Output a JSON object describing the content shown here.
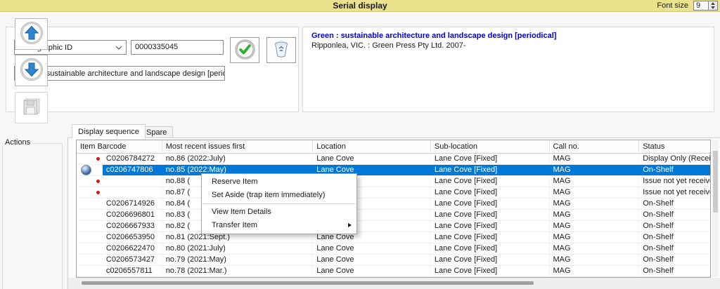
{
  "colors": {
    "titlebar_bg": "#eae28d",
    "selection": "#0078d7",
    "record_title": "#0000e6",
    "red_dot": "#dd1111"
  },
  "window": {
    "title": "Serial display",
    "font_size_label": "Font size",
    "font_size_value": "9"
  },
  "lookup": {
    "field_selector_value": "Bibliographic ID",
    "id_value": "0000335045",
    "title_selector_value": "Green : sustainable architecture and landscape design [perio"
  },
  "record": {
    "title": "Green : sustainable architecture and landscape design [periodical]",
    "imprint": "Ripponlea, VIC. : Green Press Pty Ltd. 2007-"
  },
  "actions": {
    "label": "Actions"
  },
  "tabs": [
    {
      "label": "Display sequence",
      "active": true
    },
    {
      "label": "Spare",
      "active": false
    }
  ],
  "table": {
    "columns": [
      "Item Barcode",
      "Most recent issues first",
      "Location",
      "Sub-location",
      "Call no.",
      "Status"
    ],
    "rows": [
      {
        "marker": "red-dot",
        "barcode": "C0206784272",
        "issue": "no.86 (2022:July)",
        "location": "Lane Cove",
        "sublocation": "Lane Cove [Fixed]",
        "call_no": "MAG",
        "status": "Display Only (Receive",
        "selected": false
      },
      {
        "marker": "sphere",
        "barcode": "c0206747806",
        "issue": "no.85 (2022:May)",
        "location": "Lane Cove",
        "sublocation": "Lane Cove [Fixed]",
        "call_no": "MAG",
        "status": "On-Shelf",
        "selected": true
      },
      {
        "marker": "red-dot",
        "barcode": "",
        "issue": "no.88 (",
        "location": "",
        "sublocation": "Lane Cove [Fixed]",
        "call_no": "MAG",
        "status": "Issue not yet received",
        "selected": false
      },
      {
        "marker": "red-dot",
        "barcode": "",
        "issue": "no.87 (",
        "location": "",
        "sublocation": "Lane Cove [Fixed]",
        "call_no": "MAG",
        "status": "Issue not yet received",
        "selected": false
      },
      {
        "marker": null,
        "barcode": "C0206714926",
        "issue": "no.84 (",
        "location": "",
        "sublocation": "Lane Cove [Fixed]",
        "call_no": "MAG",
        "status": "On-Shelf",
        "selected": false
      },
      {
        "marker": null,
        "barcode": "C0206696801",
        "issue": "no.83 (",
        "location": "",
        "sublocation": "Lane Cove [Fixed]",
        "call_no": "MAG",
        "status": "On-Shelf",
        "selected": false
      },
      {
        "marker": null,
        "barcode": "C0206667933",
        "issue": "no.82 (",
        "location": "",
        "sublocation": "Lane Cove [Fixed]",
        "call_no": "MAG",
        "status": "On-Shelf",
        "selected": false
      },
      {
        "marker": null,
        "barcode": "C0206653950",
        "issue": "no.81 (2021:Sept.)",
        "location": "Lane Cove",
        "sublocation": "Lane Cove [Fixed]",
        "call_no": "MAG",
        "status": "On-Shelf",
        "selected": false
      },
      {
        "marker": null,
        "barcode": "C0206622470",
        "issue": "no.80 (2021:July)",
        "location": "Lane Cove",
        "sublocation": "Lane Cove [Fixed]",
        "call_no": "MAG",
        "status": "On-Shelf",
        "selected": false
      },
      {
        "marker": null,
        "barcode": "C0206573427",
        "issue": "no.79 (2021:May)",
        "location": "Lane Cove",
        "sublocation": "Lane Cove [Fixed]",
        "call_no": "MAG",
        "status": "On-Shelf",
        "selected": false
      },
      {
        "marker": null,
        "barcode": "c0206557811",
        "issue": "no.78 (2021:Mar.)",
        "location": "Lane Cove",
        "sublocation": "Lane Cove [Fixed]",
        "call_no": "MAG",
        "status": "On-Shelf",
        "selected": false
      }
    ]
  },
  "context_menu": {
    "items": [
      {
        "label": "Reserve Item",
        "separator": false,
        "submenu": false
      },
      {
        "label": "Set Aside (trap item immediately)",
        "separator": false,
        "submenu": false
      },
      {
        "label": "",
        "separator": true,
        "submenu": false
      },
      {
        "label": "View Item Details",
        "separator": false,
        "submenu": false
      },
      {
        "label": "Transfer Item",
        "separator": false,
        "submenu": true
      }
    ]
  },
  "icons": {
    "confirm": "green-check-icon",
    "delete": "trash-icon",
    "up": "arrow-up-icon",
    "down": "arrow-down-icon",
    "save": "floppy-disk-icon"
  }
}
